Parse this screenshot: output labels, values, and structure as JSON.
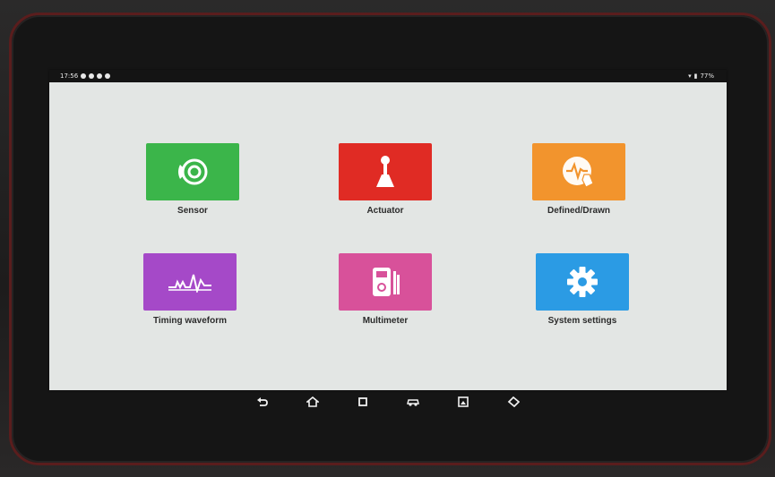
{
  "status": {
    "time": "17:56",
    "battery": "77%"
  },
  "tiles": [
    {
      "label": "Sensor",
      "color": "#3bb54a",
      "icon": "sensor-icon"
    },
    {
      "label": "Actuator",
      "color": "#e02b24",
      "icon": "actuator-icon"
    },
    {
      "label": "Defined/Drawn",
      "color": "#f2942d",
      "icon": "defined-drawn-icon"
    },
    {
      "label": "Timing waveform",
      "color": "#a549c8",
      "icon": "waveform-icon"
    },
    {
      "label": "Multimeter",
      "color": "#d8519a",
      "icon": "multimeter-icon"
    },
    {
      "label": "System settings",
      "color": "#2b9be4",
      "icon": "gear-icon"
    }
  ],
  "navbar": [
    "back-icon",
    "home-icon",
    "recents-icon",
    "car-icon",
    "screenshot-icon",
    "eraser-icon"
  ]
}
